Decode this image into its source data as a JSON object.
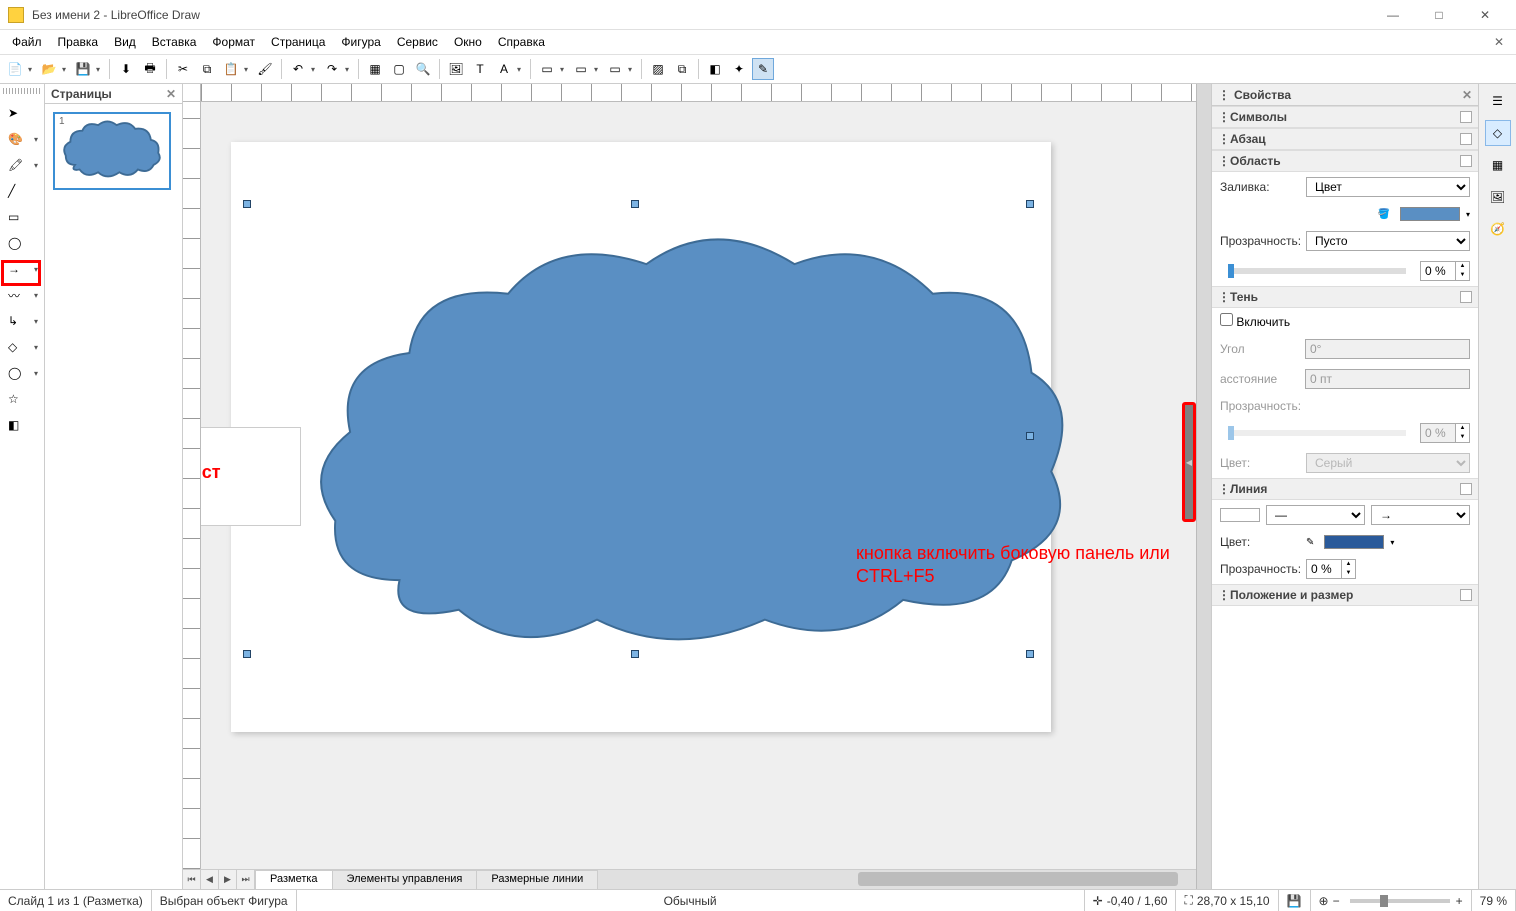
{
  "title": "Без имени 2 - LibreOffice Draw",
  "menu": [
    "Файл",
    "Правка",
    "Вид",
    "Вставка",
    "Формат",
    "Страница",
    "Фигура",
    "Сервис",
    "Окно",
    "Справка"
  ],
  "pages_panel": {
    "title": "Страницы",
    "page_num": "1"
  },
  "annot1": "Выбрать фигуру и растянуть её на лист",
  "annot2": "кнопка включить боковую панель или CTRL+F5",
  "props": {
    "title": "Свойства",
    "sections": {
      "symbols": "Символы",
      "paragraph": "Абзац",
      "area": "Область",
      "shadow": "Тень",
      "line": "Линия",
      "pos_size": "Положение и размер"
    },
    "area": {
      "fill_label": "Заливка:",
      "fill_value": "Цвет",
      "trans_label": "Прозрачность:",
      "trans_value": "Пусто",
      "trans_pct": "0 %"
    },
    "shadow": {
      "enable": "Включить",
      "angle_lbl": "Угол",
      "angle_val": "0°",
      "dist_lbl": "асстояние",
      "dist_val": "0 пт",
      "trans_lbl": "Прозрачность:",
      "trans_pct": "0 %",
      "color_lbl": "Цвет:",
      "color_val": "Серый"
    },
    "line": {
      "color_lbl": "Цвет:",
      "trans_lbl": "Прозрачность:",
      "trans_pct": "0 %"
    }
  },
  "bottom_tabs": [
    "Разметка",
    "Элементы управления",
    "Размерные линии"
  ],
  "status": {
    "slide": "Слайд 1 из 1 (Разметка)",
    "sel": "Выбран объект Фигура",
    "mode": "Обычный",
    "coords": "-0,40 / 1,60",
    "size": "28,70 x 15,10",
    "zoom": "79 %"
  }
}
